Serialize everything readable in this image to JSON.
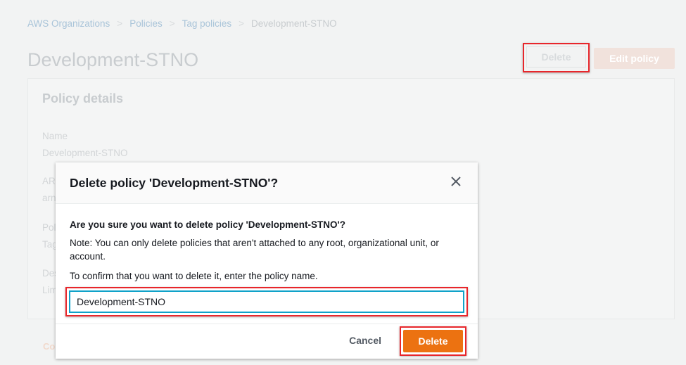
{
  "breadcrumb": [
    "AWS Organizations",
    "Policies",
    "Tag policies",
    "Development-STNO"
  ],
  "page_title": "Development-STNO",
  "header_buttons": {
    "delete": "Delete",
    "edit": "Edit policy"
  },
  "card": {
    "title": "Policy details",
    "name_label": "Name",
    "name_value": "Development-STNO",
    "fragments": [
      "AR",
      "arn",
      "Pol",
      "Tag",
      "Des",
      "Lim"
    ]
  },
  "bottom_fragment": "Co",
  "modal": {
    "title": "Delete policy 'Development-STNO'?",
    "question": "Are you sure you want to delete policy 'Development-STNO'?",
    "note": "Note: You can only delete policies that aren't attached to any root, organizational unit, or account.",
    "confirm": "To confirm that you want to delete it, enter the policy name.",
    "input_value": "Development-STNO",
    "cancel": "Cancel",
    "delete": "Delete"
  }
}
